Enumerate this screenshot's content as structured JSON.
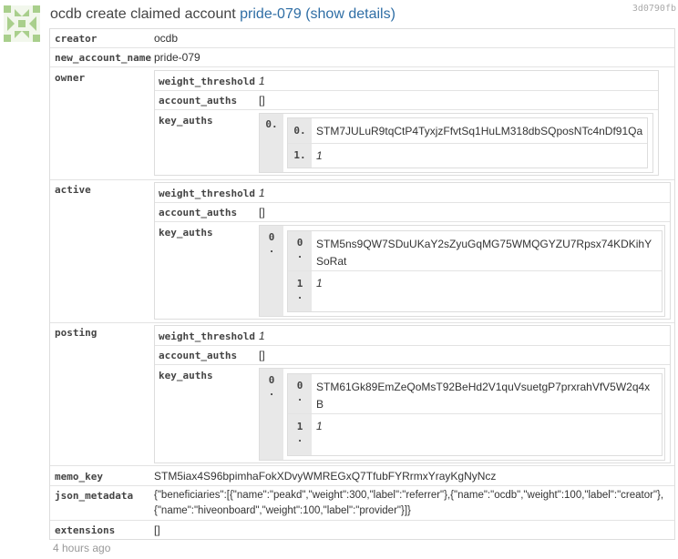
{
  "header": {
    "account": "ocdb",
    "action": "create claimed account",
    "target": "pride-079",
    "details_link": "(show details)",
    "txid": "3d0790fb"
  },
  "fields": {
    "creator": {
      "key": "creator",
      "value": "ocdb"
    },
    "new_account_name": {
      "key": "new_account_name",
      "value": "pride-079"
    },
    "owner": {
      "key": "owner",
      "weight_threshold_key": "weight_threshold",
      "weight_threshold": "1",
      "account_auths_key": "account_auths",
      "account_auths": "[]",
      "key_auths_key": "key_auths",
      "outer_index": "0.",
      "inner": [
        {
          "index": "0.",
          "value": "STM7JULuR9tqCtP4TyxjzFfvtSq1HuLM318dbSQposNTc4nDf91Qa"
        },
        {
          "index": "1.",
          "value": "1"
        }
      ]
    },
    "active": {
      "key": "active",
      "weight_threshold_key": "weight_threshold",
      "weight_threshold": "1",
      "account_auths_key": "account_auths",
      "account_auths": "[]",
      "key_auths_key": "key_auths",
      "outer_index": [
        "0",
        "."
      ],
      "inner": [
        {
          "index": [
            "0",
            "."
          ],
          "value": [
            "STM5ns9QW7SDuUKaY2sZyuGqMG75WMQGYZU7Rpsx74KDKihY",
            "SoRat"
          ]
        },
        {
          "index": [
            "1",
            "."
          ],
          "value": "1"
        }
      ]
    },
    "posting": {
      "key": "posting",
      "weight_threshold_key": "weight_threshold",
      "weight_threshold": "1",
      "account_auths_key": "account_auths",
      "account_auths": "[]",
      "key_auths_key": "key_auths",
      "outer_index": [
        "0",
        "."
      ],
      "inner": [
        {
          "index": [
            "0",
            "."
          ],
          "value": [
            "STM61Gk89EmZeQoMsT92BeHd2V1quVsuetgP7prxrahVfV5W2q4x",
            "B"
          ]
        },
        {
          "index": [
            "1",
            "."
          ],
          "value": "1"
        }
      ]
    },
    "memo_key": {
      "key": "memo_key",
      "value": "STM5iax4S96bpimhaFokXDvyWMREGxQ7TfubFYRrmxYrayKgNyNcz"
    },
    "json_metadata": {
      "key": "json_metadata",
      "lines": [
        "{\"beneficiaries\":[{\"name\":\"peakd\",\"weight\":300,\"label\":\"referrer\"},{\"name\":\"ocdb\",\"weight\":100,\"label\":\"creator\"},",
        "{\"name\":\"hiveonboard\",\"weight\":100,\"label\":\"provider\"}]}"
      ]
    },
    "extensions": {
      "key": "extensions",
      "value": "[]"
    }
  },
  "timestamp": "4 hours ago"
}
